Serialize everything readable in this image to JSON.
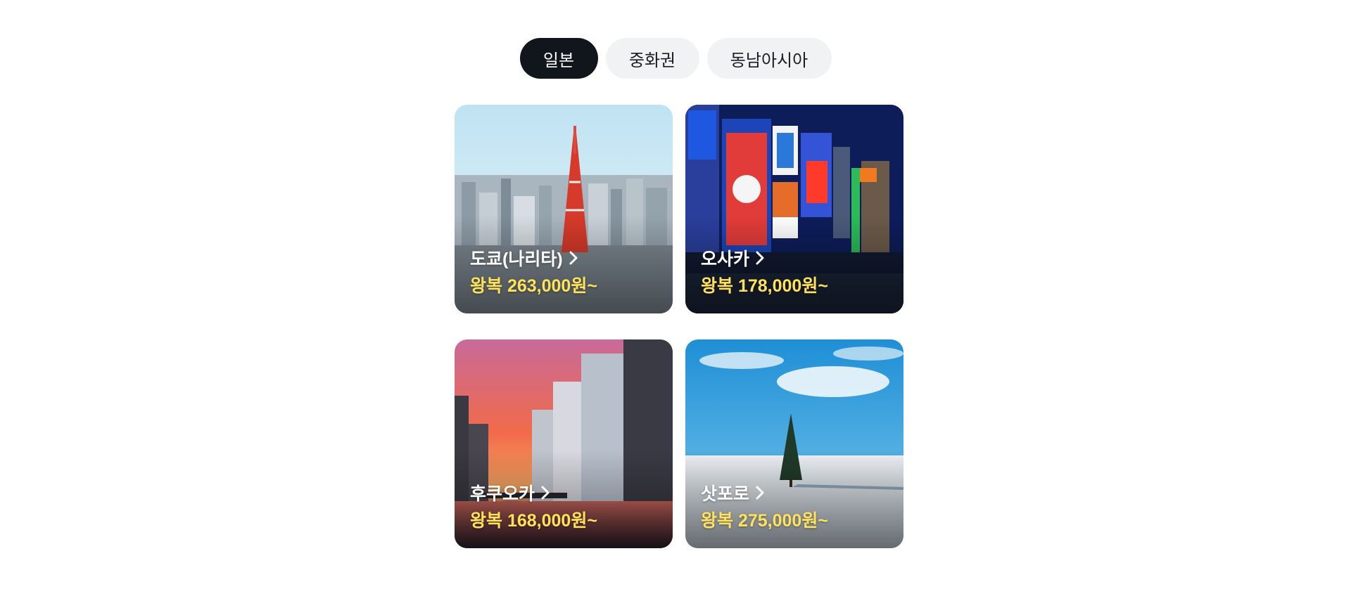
{
  "tabs": [
    {
      "label": "일본",
      "active": true
    },
    {
      "label": "중화권",
      "active": false
    },
    {
      "label": "동남아시아",
      "active": false
    }
  ],
  "destinations": [
    {
      "city": "도쿄(나리타)",
      "price": "왕복 263,000원~",
      "scene": "tokyo-tower-skyline"
    },
    {
      "city": "오사카",
      "price": "왕복 178,000원~",
      "scene": "osaka-dotonbori-signs"
    },
    {
      "city": "후쿠오카",
      "price": "왕복 168,000원~",
      "scene": "fukuoka-river-sunset"
    },
    {
      "city": "삿포로",
      "price": "왕복 275,000원~",
      "scene": "sapporo-snow-tree"
    }
  ],
  "colors": {
    "active_tab_bg": "#11161c",
    "inactive_tab_bg": "#f1f2f4",
    "price_text": "#ffe15a",
    "title_text": "#ffffff"
  },
  "icons": {
    "card_arrow": "chevron-right-icon"
  }
}
